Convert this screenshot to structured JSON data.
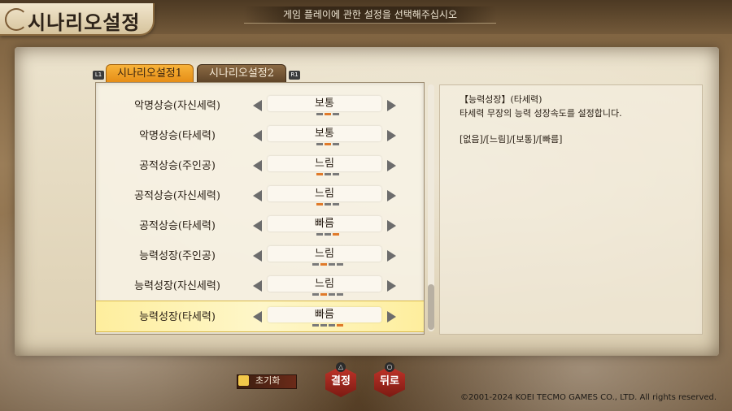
{
  "header": {
    "title": "시나리오설정",
    "instruction": "게임 플레이에 관한 설정을 선택해주십시오"
  },
  "tabs": [
    {
      "label": "시나리오설정1",
      "hint": "L1",
      "active": true
    },
    {
      "label": "시나리오설정2",
      "hint": "R1",
      "active": false
    }
  ],
  "settings": [
    {
      "label": "악명상승(자신세력)",
      "value": "보통",
      "level": 2,
      "levels": 3
    },
    {
      "label": "악명상승(타세력)",
      "value": "보통",
      "level": 2,
      "levels": 3
    },
    {
      "label": "공적상승(주인공)",
      "value": "느림",
      "level": 1,
      "levels": 3
    },
    {
      "label": "공적상승(자신세력)",
      "value": "느림",
      "level": 1,
      "levels": 3
    },
    {
      "label": "공적상승(타세력)",
      "value": "빠름",
      "level": 3,
      "levels": 3
    },
    {
      "label": "능력성장(주인공)",
      "value": "느림",
      "level": 2,
      "levels": 4
    },
    {
      "label": "능력성장(자신세력)",
      "value": "느림",
      "level": 2,
      "levels": 4
    },
    {
      "label": "능력성장(타세력)",
      "value": "빠름",
      "level": 4,
      "levels": 4
    }
  ],
  "selected_index": 7,
  "description": {
    "title": "【능력성장】(타세력)",
    "body": "타세력 무장의 능력 성장속도를 설정합니다.",
    "options": "[없음]/[느림]/[보통]/[빠름]"
  },
  "footer": {
    "reset_label": "초기화",
    "confirm_label": "결정",
    "confirm_symbol": "△",
    "back_label": "뒤로",
    "back_symbol": "○",
    "copyright": "©2001-2024 KOEI TECMO GAMES CO., LTD. All rights reserved."
  },
  "colors": {
    "tab_active": "#f0a028",
    "tick_on": "#e07a2a",
    "tick_off": "#7a7a7a",
    "selected_row": "#fff2b0",
    "hex_button": "#a8281e"
  }
}
